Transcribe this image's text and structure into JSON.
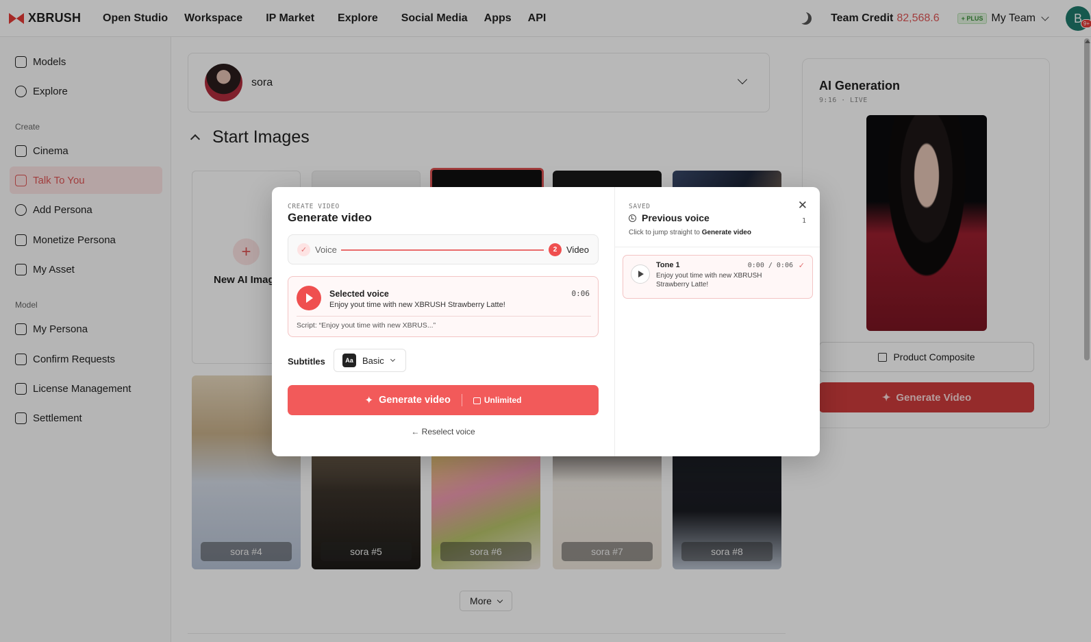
{
  "topbar": {
    "logo_text": "XBRUSH",
    "nav": [
      "Open Studio",
      "Workspace",
      "IP Market",
      "Explore",
      "Social Media",
      "Apps",
      "API"
    ],
    "credit_label": "Team Credit",
    "credit_value": "82,568.6",
    "plan_badge": "+ PLUS",
    "team_name": "My Team",
    "avatar_initial": "B",
    "notification_badge": "9+"
  },
  "sidebar": {
    "top_items": [
      {
        "label": "Models",
        "icon": "store-icon"
      },
      {
        "label": "Explore",
        "icon": "compass-icon"
      }
    ],
    "create_label": "Create",
    "create_items": [
      {
        "label": "Cinema",
        "icon": "clapper-icon"
      },
      {
        "label": "Talk To You",
        "icon": "play-square-icon",
        "active": true
      },
      {
        "label": "Add Persona",
        "icon": "user-plus-icon"
      },
      {
        "label": "Monetize Persona",
        "icon": "trend-up-icon"
      },
      {
        "label": "My Asset",
        "icon": "list-icon"
      }
    ],
    "model_label": "Model",
    "model_items": [
      {
        "label": "My Persona",
        "icon": "grid-icon"
      },
      {
        "label": "Confirm Requests",
        "icon": "file-check-icon"
      },
      {
        "label": "License Management",
        "icon": "document-icon"
      },
      {
        "label": "Settlement",
        "icon": "wallet-icon"
      }
    ]
  },
  "main": {
    "persona_name": "sora",
    "section_title": "Start Images",
    "new_image_label": "New AI Image",
    "photos": [
      "sora #4",
      "sora #5",
      "sora #6",
      "sora #7",
      "sora #8"
    ],
    "more_label": "More"
  },
  "ai_panel": {
    "title": "AI Generation",
    "subtitle": "9:16 · LIVE",
    "composite_label": "Product Composite",
    "generate_label": "Generate Video"
  },
  "modal": {
    "eyebrow": "CREATE VIDEO",
    "title": "Generate video",
    "step1_label": "Voice",
    "step2_number": "2",
    "step2_label": "Video",
    "selected_voice": {
      "title": "Selected voice",
      "text": "Enjoy yout time with new XBRUSH Strawberry Latte!",
      "duration": "0:06",
      "script": "Script: “Enjoy yout time with new XBRUS...”"
    },
    "subtitles_label": "Subtitles",
    "subtitles_badge": "Aa",
    "subtitles_value": "Basic",
    "generate_label": "Generate video",
    "unlimited_label": "Unlimited",
    "reselect_label": "← Reselect voice",
    "saved_eyebrow": "SAVED",
    "previous_title": "Previous voice",
    "previous_count": "1",
    "hint_prefix": "Click to jump straight to",
    "hint_target": "Generate video",
    "tones": [
      {
        "title": "Tone 1",
        "text": "Enjoy yout time with new XBRUSH Strawberry Latte!",
        "time": "0:00 / 0:06"
      }
    ]
  },
  "colors": {
    "accent": "#ef4f4f",
    "accent_soft": "#fbe3e3",
    "credit": "#e05555"
  }
}
